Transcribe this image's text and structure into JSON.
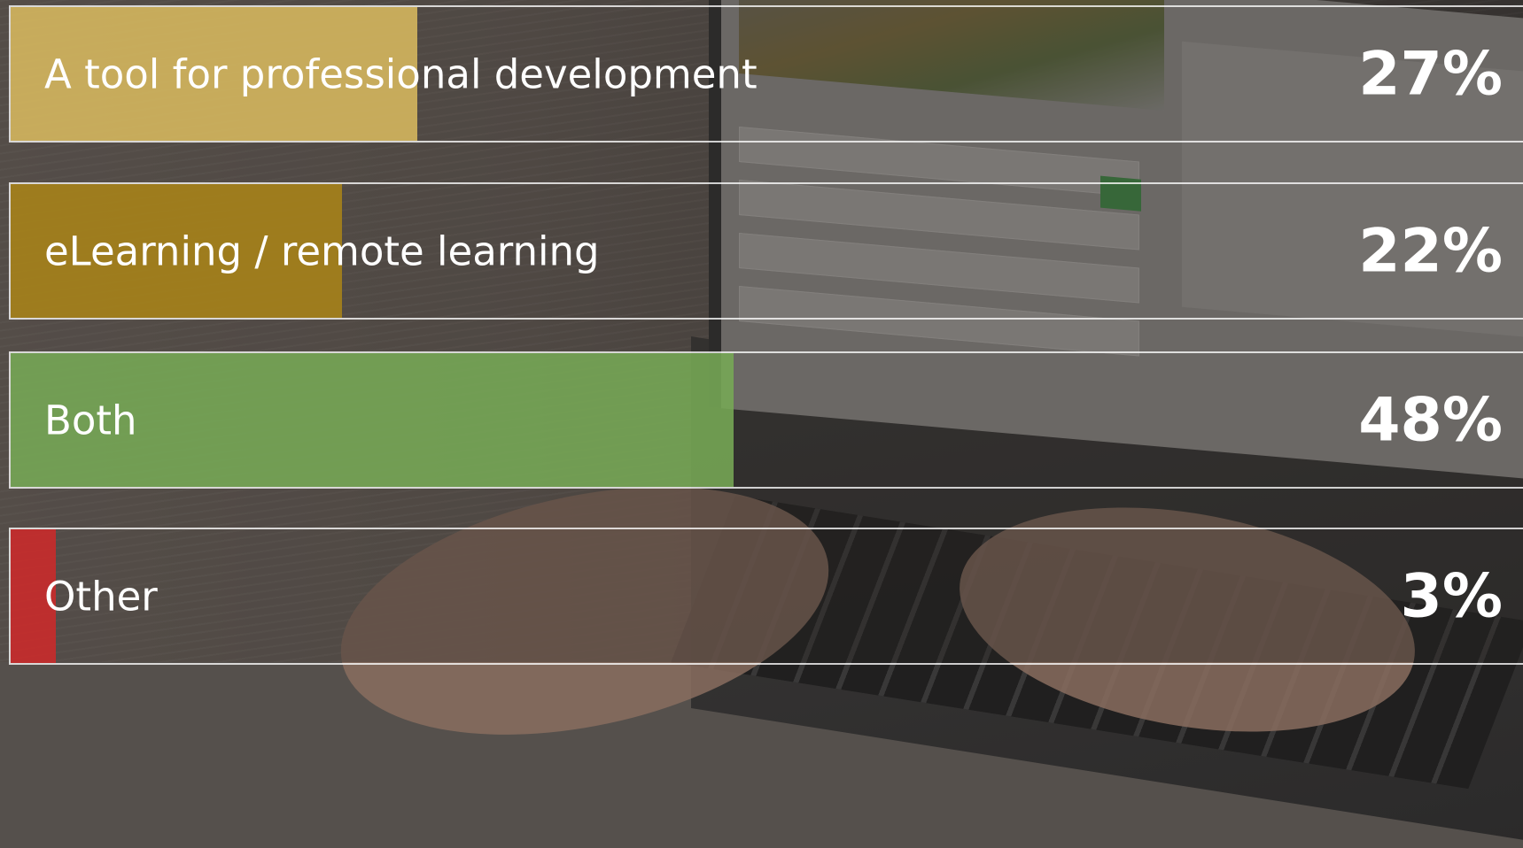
{
  "poll": {
    "options": [
      {
        "label": "A tool for professional development",
        "percent_text": "27%",
        "percent": 27,
        "color": "#d7b85e"
      },
      {
        "label": "eLearning / remote learning",
        "percent_text": "22%",
        "percent": 22,
        "color": "#a88318"
      },
      {
        "label": "Both",
        "percent_text": "48%",
        "percent": 48,
        "color": "#76a855"
      },
      {
        "label": "Other",
        "percent_text": "3%",
        "percent": 3,
        "color": "#cc2a2a"
      }
    ]
  }
}
